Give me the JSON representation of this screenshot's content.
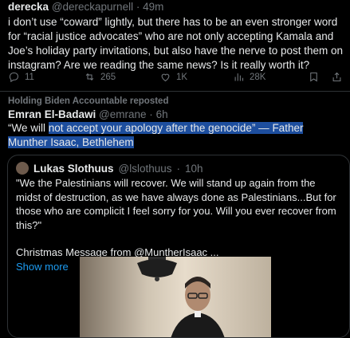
{
  "tweet1": {
    "name": "derecka",
    "handle": "@dereckapurnell",
    "time": "49m",
    "text": "i don’t use “coward” lightly, but there has to be an even stronger word for “racial justice advocates” who are not only accepting Kamala and Joe’s holiday party invitations, but also have the nerve to post them on instagram? Are we reading the same news? Is it really worth it?",
    "actions": {
      "reply": "11",
      "retweet": "265",
      "like": "1K",
      "views": "28K"
    }
  },
  "tweet2": {
    "repost_label": "Holding Biden Accountable reposted",
    "name": "Emran El-Badawi",
    "handle": "@emrane",
    "time": "6h",
    "text_plain": "“We will ",
    "text_highlight": "not accept your apology after the genocide” — Father Munther Isaac, Bethlehem",
    "quote": {
      "name": "Lukas Slothuus",
      "handle": "@lslothuus",
      "time": "10h",
      "text": "\"We the Palestinians will recover. We will stand up again from the midst of destruction, as we have always done as Palestinians...But for those who are complicit I feel sorry for you. Will you ever recover from this?\"",
      "text2": "Christmas Message from @MuntherIsaac ...",
      "show_more": "Show more"
    }
  },
  "colors": {
    "bg": "#000000",
    "text": "#e7e9ea",
    "muted": "#71767b",
    "accent": "#1d9bf0",
    "highlight": "#1d4e9e"
  }
}
